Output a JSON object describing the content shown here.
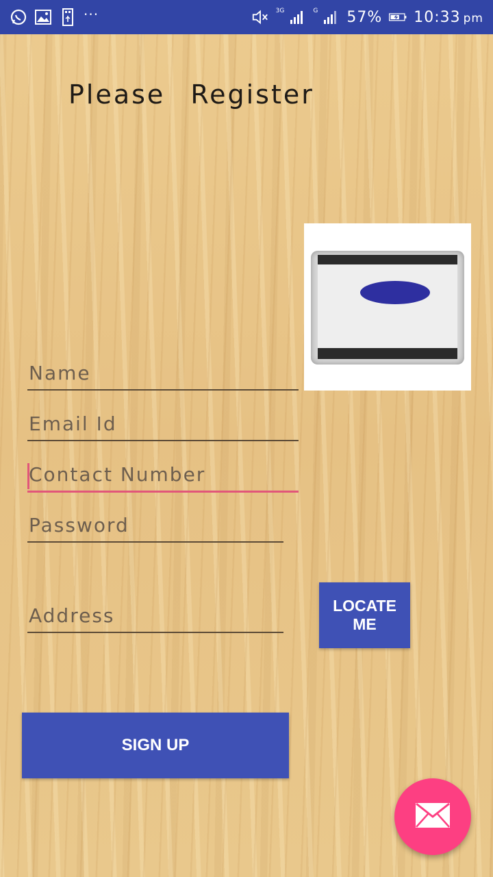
{
  "status_bar": {
    "battery": "57%",
    "time": "10:33",
    "meridiem": "pm",
    "network_1": "3G",
    "network_2": "G",
    "overflow": "···"
  },
  "title": "Please Register",
  "form": {
    "name_placeholder": "Name",
    "email_placeholder": "Email Id",
    "contact_placeholder": "Contact Number",
    "password_placeholder": "Password",
    "address_placeholder": "Address"
  },
  "buttons": {
    "locate_me": "LOCATE ME",
    "sign_up": "SIGN UP"
  },
  "icons": {
    "fab": "mail-icon"
  },
  "colors": {
    "status_bar": "#3245a6",
    "primary_button": "#3f51b5",
    "fab": "#fd3f82",
    "focus_accent": "#e1567a"
  }
}
